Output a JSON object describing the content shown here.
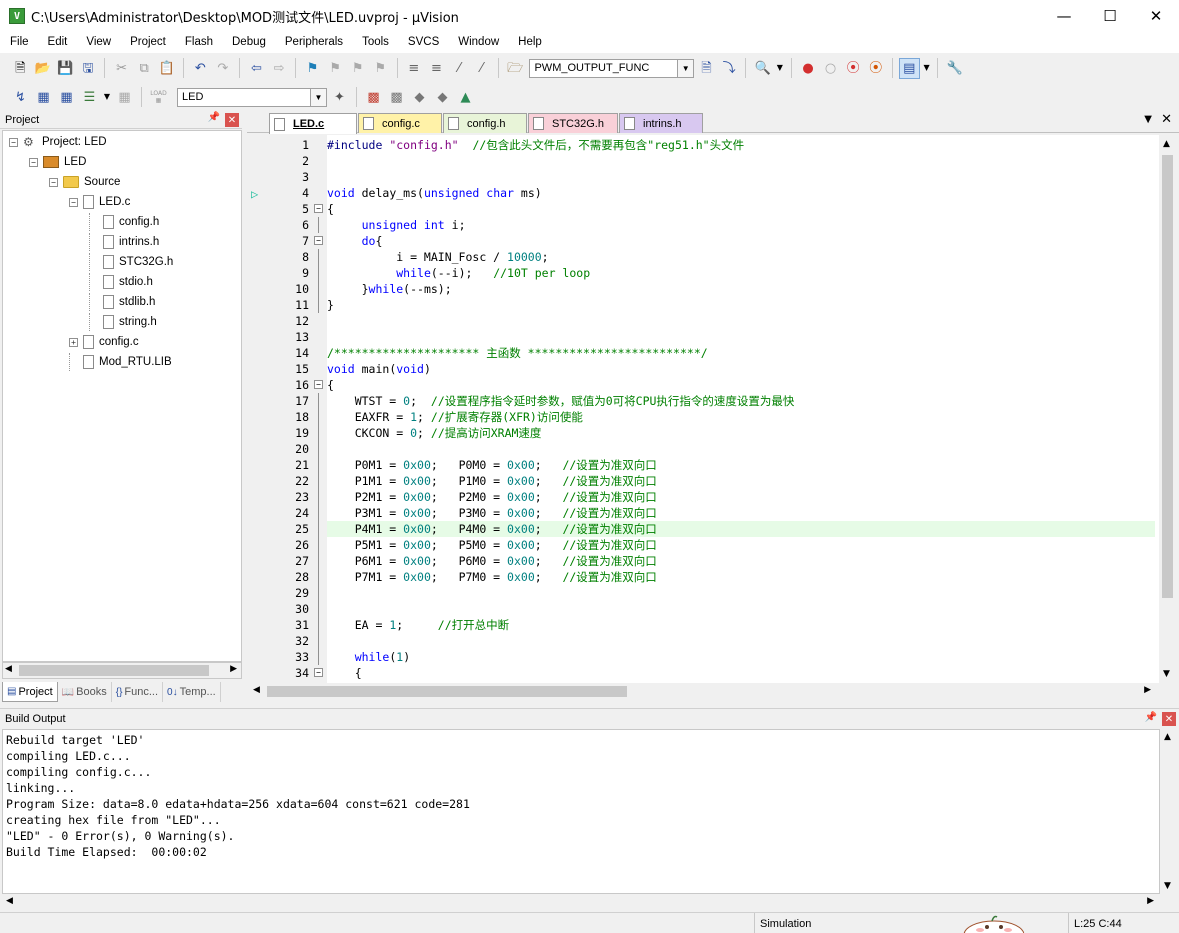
{
  "window": {
    "title": "C:\\Users\\Administrator\\Desktop\\MOD测试文件\\LED.uvproj - µVision",
    "app_icon_letter": "V"
  },
  "menu": [
    "File",
    "Edit",
    "View",
    "Project",
    "Flash",
    "Debug",
    "Peripherals",
    "Tools",
    "SVCS",
    "Window",
    "Help"
  ],
  "toolbar1": {
    "function_combo": "PWM_OUTPUT_FUNC"
  },
  "toolbar2": {
    "target_combo": "LED",
    "load_label": "LOAD"
  },
  "project_panel": {
    "title": "Project",
    "tree": [
      {
        "label": "Project: LED",
        "depth": 0,
        "expander": "−",
        "icon": "project-icon"
      },
      {
        "label": "LED",
        "depth": 1,
        "expander": "−",
        "icon": "target-icon"
      },
      {
        "label": "Source",
        "depth": 2,
        "expander": "−",
        "icon": "folder-icon"
      },
      {
        "label": "LED.c",
        "depth": 3,
        "expander": "−",
        "icon": "file-icon"
      },
      {
        "label": "config.h",
        "depth": 4,
        "expander": "",
        "icon": "file-icon"
      },
      {
        "label": "intrins.h",
        "depth": 4,
        "expander": "",
        "icon": "file-icon"
      },
      {
        "label": "STC32G.h",
        "depth": 4,
        "expander": "",
        "icon": "file-icon"
      },
      {
        "label": "stdio.h",
        "depth": 4,
        "expander": "",
        "icon": "file-icon"
      },
      {
        "label": "stdlib.h",
        "depth": 4,
        "expander": "",
        "icon": "file-icon"
      },
      {
        "label": "string.h",
        "depth": 4,
        "expander": "",
        "icon": "file-icon"
      },
      {
        "label": "config.c",
        "depth": 3,
        "expander": "+",
        "icon": "file-icon"
      },
      {
        "label": "Mod_RTU.LIB",
        "depth": 3,
        "expander": "",
        "icon": "file-icon"
      }
    ],
    "tabs": [
      "Project",
      "Books",
      "Func...",
      "Temp..."
    ]
  },
  "editor": {
    "tabs": [
      {
        "label": "LED.c",
        "color": "#ffffff",
        "active": true
      },
      {
        "label": "config.c",
        "color": "#fff2a8",
        "active": false
      },
      {
        "label": "config.h",
        "color": "#e8f4d8",
        "active": false
      },
      {
        "label": "STC32G.h",
        "color": "#f9d0d8",
        "active": false
      },
      {
        "label": "intrins.h",
        "color": "#d8c8f0",
        "active": false
      }
    ],
    "highlight_line": 25,
    "lines": [
      {
        "n": "1",
        "html": "<span class='op'>#include</span> <span class='st'>\"config.h\"</span>  <span class='cm'>//包含此头文件后，不需要再包含\"reg51.h\"头文件</span>"
      },
      {
        "n": "2",
        "html": ""
      },
      {
        "n": "3",
        "html": ""
      },
      {
        "n": "4",
        "html": "<span class='kw'>void</span> delay_ms(<span class='kw'>unsigned char</span> ms)"
      },
      {
        "n": "5",
        "html": "{"
      },
      {
        "n": "6",
        "html": "     <span class='kw'>unsigned int</span> i;"
      },
      {
        "n": "7",
        "html": "     <span class='kw'>do</span>{"
      },
      {
        "n": "8",
        "html": "          i = MAIN_Fosc / <span class='nm'>10000</span>;"
      },
      {
        "n": "9",
        "html": "          <span class='kw'>while</span>(--i);   <span class='cm'>//10T per loop</span>"
      },
      {
        "n": "10",
        "html": "     }<span class='kw'>while</span>(--ms);"
      },
      {
        "n": "11",
        "html": "}"
      },
      {
        "n": "12",
        "html": ""
      },
      {
        "n": "13",
        "html": ""
      },
      {
        "n": "14",
        "html": "<span class='cm'>/********************* 主函数 *************************/</span>"
      },
      {
        "n": "15",
        "html": "<span class='kw'>void</span> main(<span class='kw'>void</span>)"
      },
      {
        "n": "16",
        "html": "{"
      },
      {
        "n": "17",
        "html": "    WTST = <span class='nm'>0</span>;  <span class='cm'>//设置程序指令延时参数，赋值为0可将CPU执行指令的速度设置为最快</span>"
      },
      {
        "n": "18",
        "html": "    EAXFR = <span class='nm'>1</span>; <span class='cm'>//扩展寄存器(XFR)访问使能</span>"
      },
      {
        "n": "19",
        "html": "    CKCON = <span class='nm'>0</span>; <span class='cm'>//提高访问XRAM速度</span>"
      },
      {
        "n": "20",
        "html": ""
      },
      {
        "n": "21",
        "html": "    P0M1 = <span class='nm'>0x00</span>;   P0M0 = <span class='nm'>0x00</span>;   <span class='cm'>//设置为准双向口</span>"
      },
      {
        "n": "22",
        "html": "    P1M1 = <span class='nm'>0x00</span>;   P1M0 = <span class='nm'>0x00</span>;   <span class='cm'>//设置为准双向口</span>"
      },
      {
        "n": "23",
        "html": "    P2M1 = <span class='nm'>0x00</span>;   P2M0 = <span class='nm'>0x00</span>;   <span class='cm'>//设置为准双向口</span>"
      },
      {
        "n": "24",
        "html": "    P3M1 = <span class='nm'>0x00</span>;   P3M0 = <span class='nm'>0x00</span>;   <span class='cm'>//设置为准双向口</span>"
      },
      {
        "n": "25",
        "html": "    P4M1 = <span class='nm'>0x00</span>;   P4M0 = <span class='nm'>0x00</span>;   <span class='cm'>//设置为准双向口</span>"
      },
      {
        "n": "26",
        "html": "    P5M1 = <span class='nm'>0x00</span>;   P5M0 = <span class='nm'>0x00</span>;   <span class='cm'>//设置为准双向口</span>"
      },
      {
        "n": "27",
        "html": "    P6M1 = <span class='nm'>0x00</span>;   P6M0 = <span class='nm'>0x00</span>;   <span class='cm'>//设置为准双向口</span>"
      },
      {
        "n": "28",
        "html": "    P7M1 = <span class='nm'>0x00</span>;   P7M0 = <span class='nm'>0x00</span>;   <span class='cm'>//设置为准双向口</span>"
      },
      {
        "n": "29",
        "html": ""
      },
      {
        "n": "30",
        "html": ""
      },
      {
        "n": "31",
        "html": "    EA = <span class='nm'>1</span>;     <span class='cm'>//打开总中断</span>"
      },
      {
        "n": "32",
        "html": ""
      },
      {
        "n": "33",
        "html": "    <span class='kw'>while</span>(<span class='nm'>1</span>)"
      },
      {
        "n": "34",
        "html": "    {"
      }
    ]
  },
  "build_output": {
    "title": "Build Output",
    "text": "Rebuild target 'LED'\ncompiling LED.c...\ncompiling config.c...\nlinking...\nProgram Size: data=8.0 edata+hdata=256 xdata=604 const=621 code=281\ncreating hex file from \"LED\"...\n\"LED\" - 0 Error(s), 0 Warning(s).\nBuild Time Elapsed:  00:00:02"
  },
  "status": {
    "mode": "Simulation",
    "position": "L:25 C:44"
  }
}
